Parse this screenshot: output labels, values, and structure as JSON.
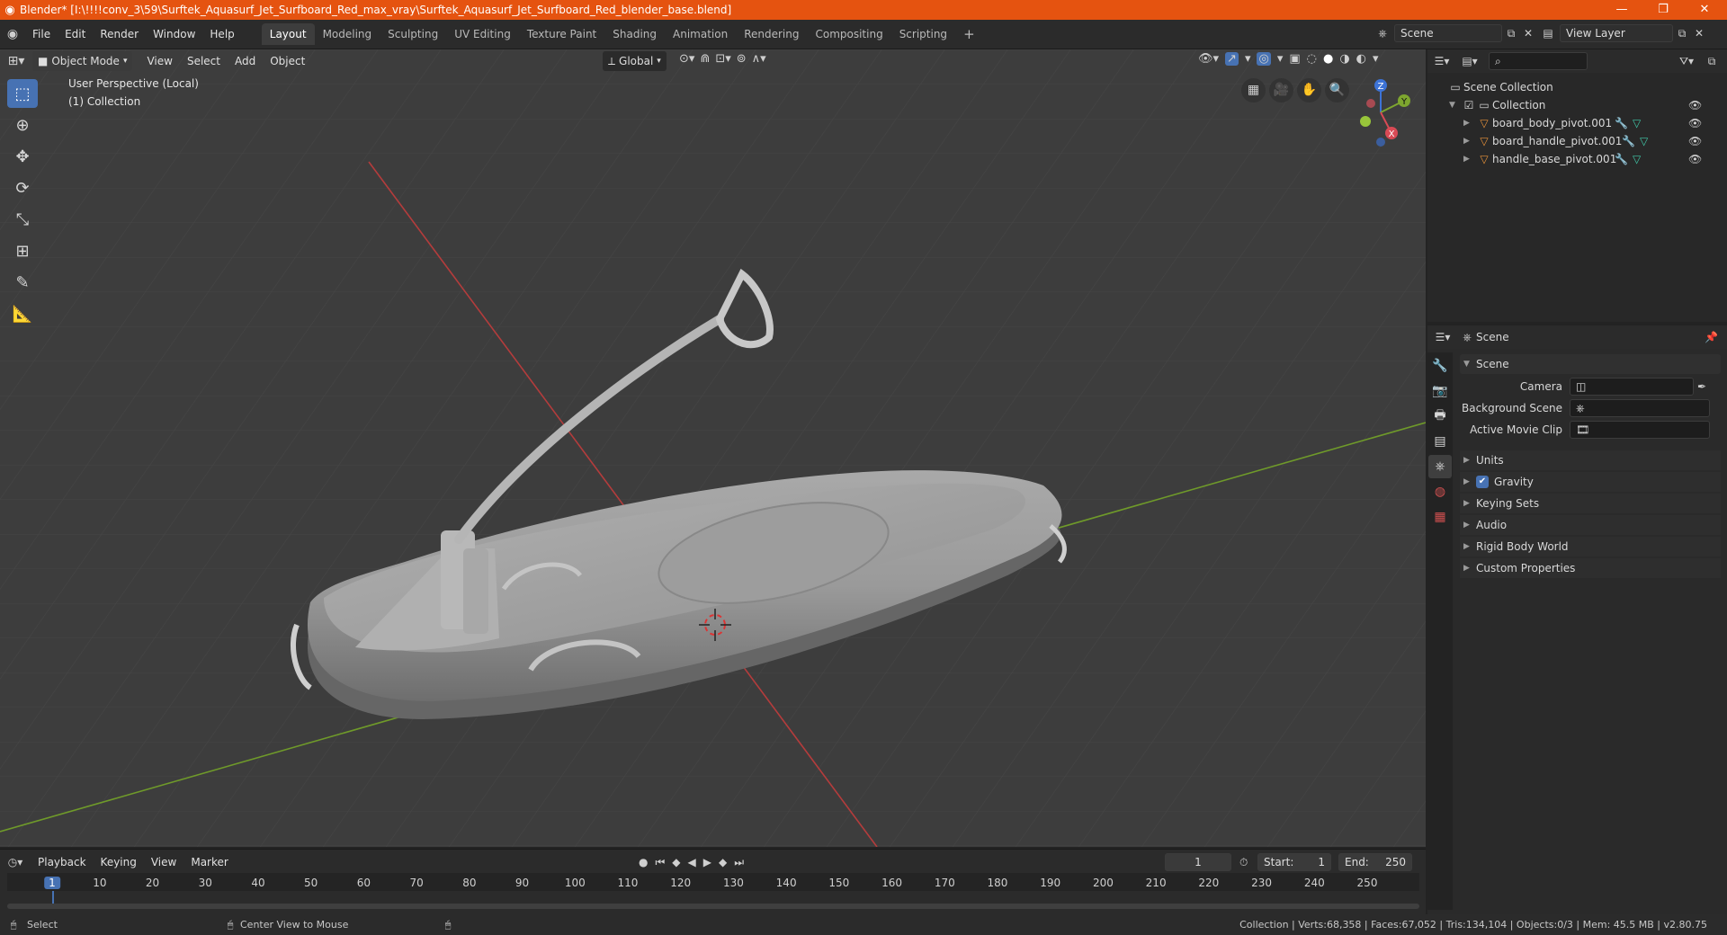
{
  "window": {
    "title": "Blender* [I:\\!!!!conv_3\\59\\Surftek_Aquasurf_Jet_Surfboard_Red_max_vray\\Surftek_Aquasurf_Jet_Surfboard_Red_blender_base.blend]"
  },
  "menus": [
    "File",
    "Edit",
    "Render",
    "Window",
    "Help"
  ],
  "workspaces": [
    "Layout",
    "Modeling",
    "Sculpting",
    "UV Editing",
    "Texture Paint",
    "Shading",
    "Animation",
    "Rendering",
    "Compositing",
    "Scripting"
  ],
  "workspace_add": "+",
  "scene_field": "Scene",
  "view_layer_field": "View Layer",
  "viewport": {
    "mode": "Object Mode",
    "menus": [
      "View",
      "Select",
      "Add",
      "Object"
    ],
    "orientation": "Global",
    "overlay_text_1": "User Perspective (Local)",
    "overlay_text_2": "(1) Collection",
    "gizmo": {
      "x": "X",
      "y": "Y",
      "z": "Z"
    }
  },
  "outliner": {
    "root": "Scene Collection",
    "collection": "Collection",
    "objects": [
      "board_body_pivot.001",
      "board_handle_pivot.001",
      "handle_base_pivot.001"
    ]
  },
  "properties": {
    "header": "Scene",
    "panel": "Scene",
    "fields": [
      {
        "label": "Camera",
        "value": ""
      },
      {
        "label": "Background Scene",
        "value": ""
      },
      {
        "label": "Active Movie Clip",
        "value": ""
      }
    ],
    "subpanels": [
      "Units",
      "Gravity",
      "Keying Sets",
      "Audio",
      "Rigid Body World",
      "Custom Properties"
    ],
    "gravity_checked": true
  },
  "timeline": {
    "menus": [
      "Playback",
      "Keying",
      "View",
      "Marker"
    ],
    "current_frame": "1",
    "start_label": "Start:",
    "start": "1",
    "end_label": "End:",
    "end": "250",
    "ticks": [
      "1",
      "10",
      "20",
      "30",
      "40",
      "50",
      "60",
      "70",
      "80",
      "90",
      "100",
      "110",
      "120",
      "130",
      "140",
      "150",
      "160",
      "170",
      "180",
      "190",
      "200",
      "210",
      "220",
      "230",
      "240",
      "250"
    ]
  },
  "status": {
    "left_action": "Select",
    "mid_action": "Center View to Mouse",
    "stats": "Collection | Verts:68,358 | Faces:67,052 | Tris:134,104 | Objects:0/3 | Mem: 45.5 MB | v2.80.75"
  },
  "colors": {
    "accent": "#4772b3",
    "titlebar": "#e55310",
    "x_axis": "#c83a3a",
    "y_axis": "#6f9a2a"
  }
}
